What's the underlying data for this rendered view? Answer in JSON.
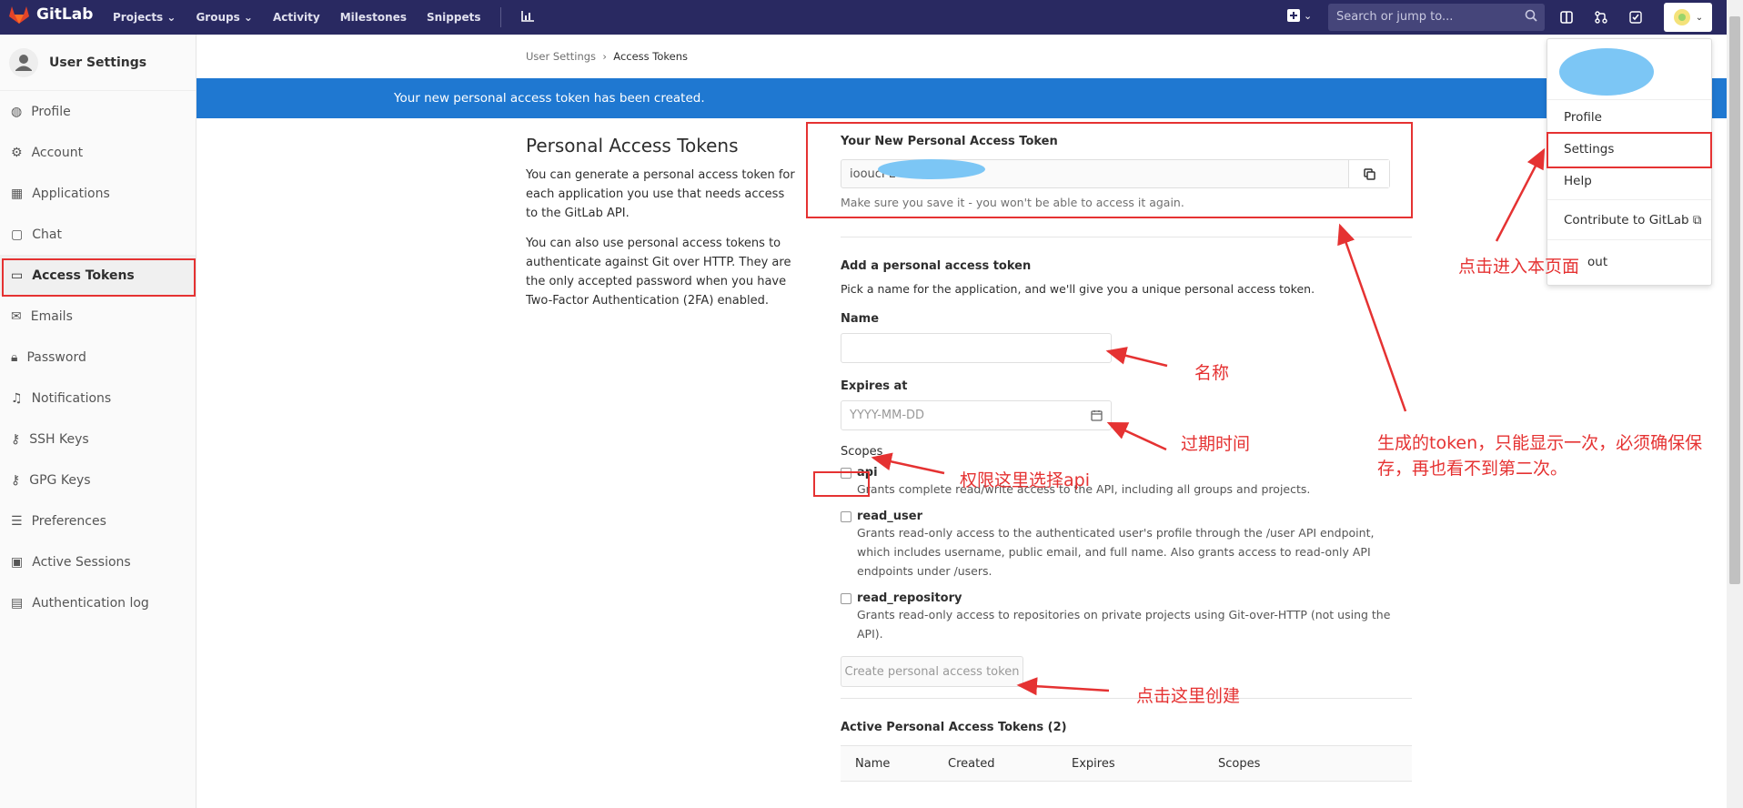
{
  "app": {
    "name": "GitLab"
  },
  "nav": {
    "items": [
      "Projects",
      "Groups",
      "Activity",
      "Milestones",
      "Snippets"
    ]
  },
  "search": {
    "placeholder": "Search or jump to..."
  },
  "sidebar": {
    "title": "User Settings",
    "items": [
      {
        "label": "Profile",
        "icon": "profile-icon"
      },
      {
        "label": "Account",
        "icon": "account-icon"
      },
      {
        "label": "Applications",
        "icon": "applications-icon"
      },
      {
        "label": "Chat",
        "icon": "chat-icon"
      },
      {
        "label": "Access Tokens",
        "icon": "token-icon",
        "active": true
      },
      {
        "label": "Emails",
        "icon": "mail-icon"
      },
      {
        "label": "Password",
        "icon": "lock-icon"
      },
      {
        "label": "Notifications",
        "icon": "bell-icon"
      },
      {
        "label": "SSH Keys",
        "icon": "key-icon"
      },
      {
        "label": "GPG Keys",
        "icon": "key-icon"
      },
      {
        "label": "Preferences",
        "icon": "sliders-icon"
      },
      {
        "label": "Active Sessions",
        "icon": "monitor-icon"
      },
      {
        "label": "Authentication log",
        "icon": "log-icon"
      }
    ]
  },
  "breadcrumb": {
    "parent": "User Settings",
    "current": "Access Tokens"
  },
  "flash": {
    "message": "Your new personal access token has been created."
  },
  "intro": {
    "title": "Personal Access Tokens",
    "p1": "You can generate a personal access token for each application you use that needs access to the GitLab API.",
    "p2": "You can also use personal access tokens to authenticate against Git over HTTP. They are the only accepted password when you have Two-Factor Authentication (2FA) enabled."
  },
  "new_token": {
    "label": "Your New Personal Access Token",
    "value": "iooucPL",
    "help": "Make sure you save it - you won't be able to access it again."
  },
  "form": {
    "heading": "Add a personal access token",
    "subtext": "Pick a name for the application, and we'll give you a unique personal access token.",
    "name_label": "Name",
    "name_value": "",
    "expires_label": "Expires at",
    "expires_placeholder": "YYYY-MM-DD",
    "scopes_label": "Scopes",
    "scopes": [
      {
        "name": "api",
        "desc": "Grants complete read/write access to the API, including all groups and projects."
      },
      {
        "name": "read_user",
        "desc": "Grants read-only access to the authenticated user's profile through the /user API endpoint, which includes username, public email, and full name. Also grants access to read-only API endpoints under /users."
      },
      {
        "name": "read_repository",
        "desc": "Grants read-only access to repositories on private projects using Git-over-HTTP (not using the API)."
      }
    ],
    "submit_label": "Create personal access token"
  },
  "active_tokens": {
    "heading": "Active Personal Access Tokens (2)",
    "columns": [
      "Name",
      "Created",
      "Expires",
      "Scopes"
    ]
  },
  "dropdown": {
    "items": [
      "Profile",
      "Settings",
      "Help",
      "Contribute to GitLab",
      "Sign out"
    ],
    "sign_out_visible": "out"
  },
  "annotations": {
    "enter_page": "点击进入本页面",
    "name": "名称",
    "expiry": "过期时间",
    "token_note": "生成的token，只能显示一次，必须确保保存，再也看不到第二次。",
    "scope_note": "权限这里选择api",
    "create_note": "点击这里创建"
  },
  "colors": {
    "topbar": "#292961",
    "flash": "#1f78d1",
    "annotation": "#e53232"
  }
}
